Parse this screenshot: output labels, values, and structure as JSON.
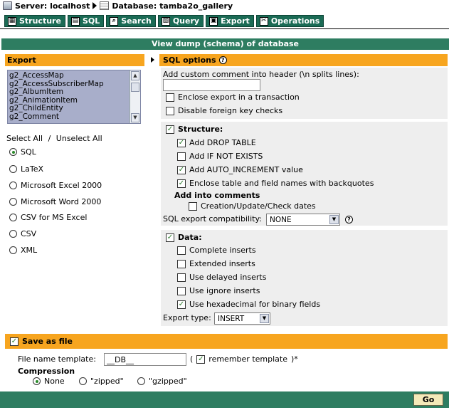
{
  "breadcrumb": {
    "server_label": "Server: localhost",
    "database_label": "Database: tamba2o_gallery"
  },
  "tabs": [
    {
      "label": "Structure",
      "icon": "structure-icon"
    },
    {
      "label": "SQL",
      "icon": "sql-icon"
    },
    {
      "label": "Search",
      "icon": "search-icon"
    },
    {
      "label": "Query",
      "icon": "query-icon"
    },
    {
      "label": "Export",
      "icon": "export-icon"
    },
    {
      "label": "Operations",
      "icon": "operations-icon"
    }
  ],
  "page_title": "View dump (schema) of database",
  "export": {
    "heading": "Export",
    "tables": [
      "g2_AccessMap",
      "g2_AccessSubscriberMap",
      "g2_AlbumItem",
      "g2_AnimationItem",
      "g2_ChildEntity",
      "g2_Comment"
    ],
    "select_all": "Select All",
    "separator": "/",
    "unselect_all": "Unselect All",
    "formats": [
      {
        "label": "SQL",
        "selected": true
      },
      {
        "label": "LaTeX",
        "selected": false
      },
      {
        "label": "Microsoft Excel 2000",
        "selected": false
      },
      {
        "label": "Microsoft Word 2000",
        "selected": false
      },
      {
        "label": "CSV for MS Excel",
        "selected": false
      },
      {
        "label": "CSV",
        "selected": false
      },
      {
        "label": "XML",
        "selected": false
      }
    ]
  },
  "sql_options": {
    "heading": "SQL options",
    "comment_label": "Add custom comment into header (\\n splits lines):",
    "comment_value": "",
    "transaction": {
      "label": "Enclose export in a transaction",
      "checked": false
    },
    "foreign_keys": {
      "label": "Disable foreign key checks",
      "checked": false
    }
  },
  "structure": {
    "label": "Structure:",
    "checked": true,
    "drop_table": {
      "label": "Add DROP TABLE",
      "checked": true
    },
    "if_not_exists": {
      "label": "Add IF NOT EXISTS",
      "checked": false
    },
    "auto_increment": {
      "label": "Add AUTO_INCREMENT value",
      "checked": true
    },
    "backquotes": {
      "label": "Enclose table and field names with backquotes",
      "checked": true
    },
    "comments_heading": "Add into comments",
    "dates": {
      "label": "Creation/Update/Check dates",
      "checked": false
    },
    "compat_label": "SQL export compatibility:",
    "compat_value": "NONE"
  },
  "data": {
    "label": "Data:",
    "checked": true,
    "complete": {
      "label": "Complete inserts",
      "checked": false
    },
    "extended": {
      "label": "Extended inserts",
      "checked": false
    },
    "delayed": {
      "label": "Use delayed inserts",
      "checked": false
    },
    "ignore": {
      "label": "Use ignore inserts",
      "checked": false
    },
    "hex": {
      "label": "Use hexadecimal for binary fields",
      "checked": true
    },
    "export_type_label": "Export type:",
    "export_type_value": "INSERT"
  },
  "save_as_file": {
    "label": "Save as file",
    "checked": true,
    "template_label": "File name template:",
    "template_value": "__DB__",
    "paren_open": "(",
    "remember_label": "remember template",
    "remember_checked": true,
    "paren_close": ")*",
    "compression_label": "Compression",
    "compression_options": [
      {
        "label": "None",
        "selected": true
      },
      {
        "label": "\"zipped\"",
        "selected": false
      },
      {
        "label": "\"gzipped\"",
        "selected": false
      }
    ]
  },
  "go_label": "Go",
  "colors": {
    "tab_green": "#1b6b55",
    "bar_green": "#2e7d61",
    "header_orange": "#f7a51f",
    "panel_gray": "#eeeeee",
    "list_bg": "#a8aeca"
  }
}
